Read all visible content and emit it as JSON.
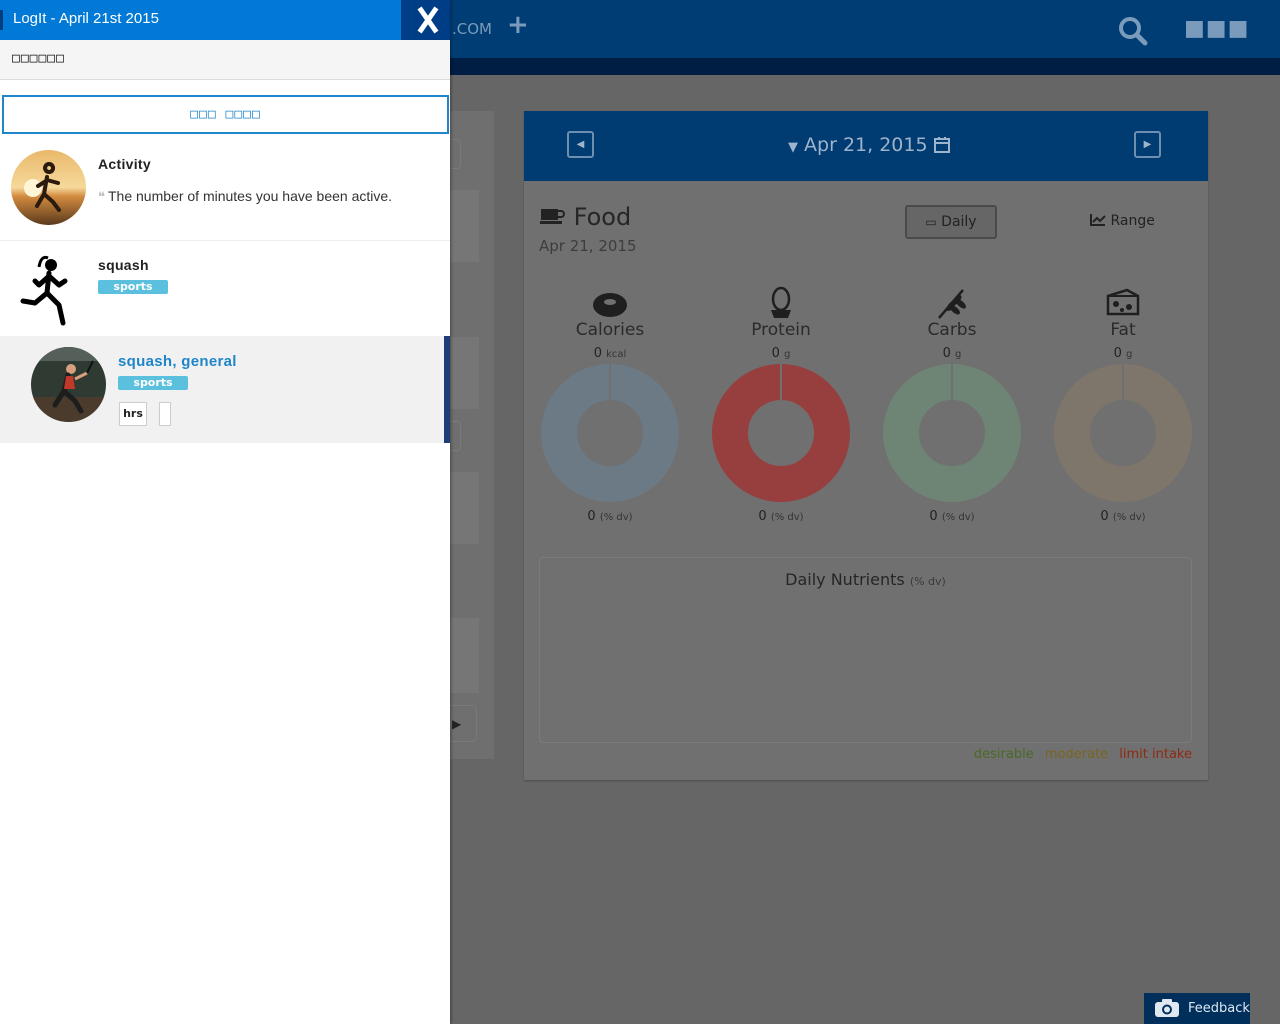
{
  "app": {
    "brand_fragment": ".COM",
    "topbar": {
      "plus_icon": "plus-icon",
      "search_icon": "search-icon",
      "more_icon": "more-icon"
    }
  },
  "drawer": {
    "title": "LogIt - April 21st 2015",
    "subheader": "□□□□□□",
    "search_placeholder": "□□□ □□□□",
    "items": [
      {
        "title": "Activity",
        "description": "The number of minutes you have been active.",
        "icon": "quote-icon"
      },
      {
        "title": "squash",
        "badge": "sports"
      },
      {
        "title": "squash, general",
        "badge": "sports",
        "unit": "hrs",
        "value": ""
      }
    ]
  },
  "food_card": {
    "date_nav": "Apr 21, 2015",
    "title": "Food",
    "date": "Apr 21, 2015",
    "daily_label": "Daily",
    "range_label": "Range",
    "macros": [
      {
        "name": "Calories",
        "value": "0",
        "unit": "kcal",
        "dv": "0",
        "dv_unit": "(% dv)",
        "color": "#6c7a86"
      },
      {
        "name": "Protein",
        "value": "0",
        "unit": "g",
        "dv": "0",
        "dv_unit": "(% dv)",
        "color": "#973e3e"
      },
      {
        "name": "Carbs",
        "value": "0",
        "unit": "g",
        "dv": "0",
        "dv_unit": "(% dv)",
        "color": "#6e8576"
      },
      {
        "name": "Fat",
        "value": "0",
        "unit": "g",
        "dv": "0",
        "dv_unit": "(% dv)",
        "color": "#7f766b"
      }
    ],
    "nutrients_title": "Daily Nutrients",
    "nutrients_unit": "(% dv)",
    "legend": [
      {
        "label": "desirable",
        "color": "#4a6a25"
      },
      {
        "label": "moderate",
        "color": "#7a6422"
      },
      {
        "label": "limit intake",
        "color": "#8e2a12"
      }
    ]
  },
  "feedback": {
    "label": "Feedback"
  }
}
